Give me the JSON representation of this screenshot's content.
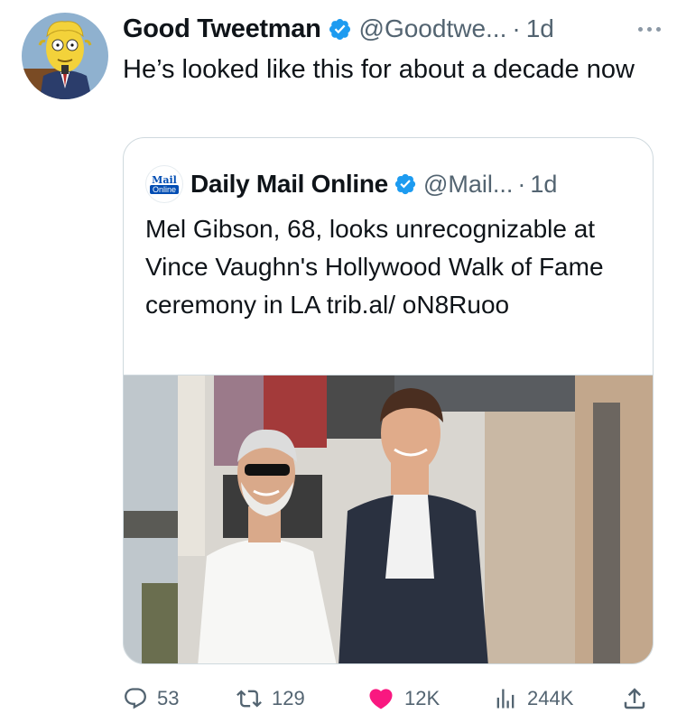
{
  "tweet": {
    "author_name": "Good Tweetman",
    "handle": "@Goodtwe...",
    "separator": "·",
    "time": "1d",
    "text": "He’s looked like this for about a decade now"
  },
  "quoted": {
    "author_name": "Daily Mail Online",
    "avatar_line1": "Mail",
    "avatar_line2": "Online",
    "handle": "@Mail...",
    "separator": "·",
    "time": "1d",
    "text": "Mel Gibson, 68, looks unrecognizable at Vince Vaughn's Hollywood Walk of Fame ceremony in LA trib.al/ oN8Ruoo"
  },
  "actions": {
    "replies": "53",
    "retweets": "129",
    "likes": "12K",
    "views": "244K"
  },
  "colors": {
    "verified": "#1d9bf0",
    "like": "#f91880",
    "muted": "#536471",
    "border": "#cfd9de"
  },
  "icons": [
    "verified-badge-icon",
    "more-icon",
    "reply-icon",
    "retweet-icon",
    "heart-icon",
    "views-icon",
    "share-icon"
  ]
}
